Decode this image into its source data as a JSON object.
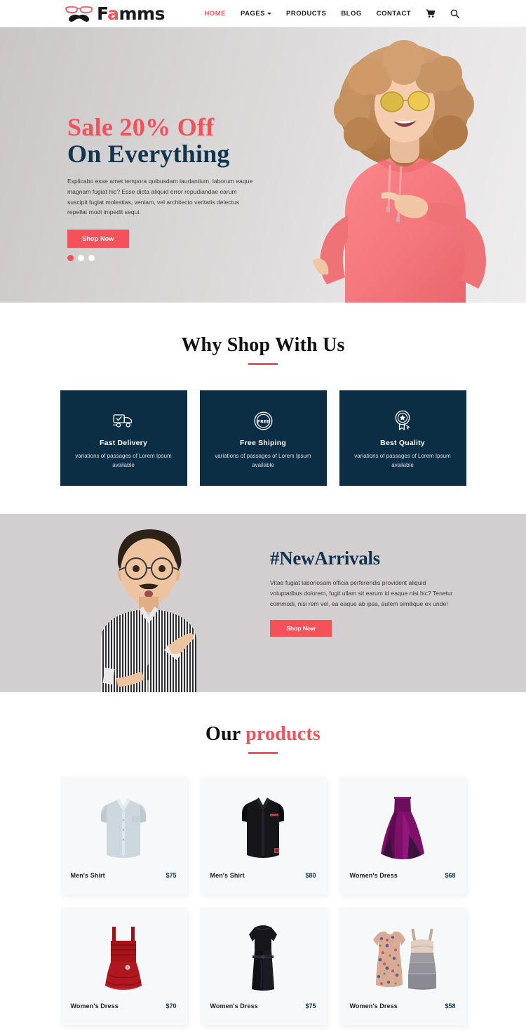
{
  "header": {
    "logo": {
      "part_dark_1": "F",
      "part_red": "a",
      "part_dark_2": "mms",
      "icon": "glasses-mustache-logo"
    },
    "nav": [
      {
        "label": "HOME",
        "active": true
      },
      {
        "label": "PAGES",
        "active": false,
        "has_dropdown": true
      },
      {
        "label": "PRODUCTS",
        "active": false
      },
      {
        "label": "BLOG",
        "active": false
      },
      {
        "label": "CONTACT",
        "active": false
      }
    ],
    "cart_icon": "shopping-cart-icon",
    "search_icon": "search-icon"
  },
  "hero": {
    "title_line1": "Sale 20%  Off",
    "title_line2": "On Everything",
    "description": "Explicabo esse amet tempora quibusdam laudantium, laborum eaque magnam fugiat hic? Esse dicta aliquid error repudiandae earum suscipit fugiat molestias, veniam, vel architecto veritatis delectus repellat modi impedit sequi.",
    "cta_label": "Shop Now",
    "slide_count": 3,
    "active_slide": 1,
    "image_alt": "woman-in-pink-hoodie-with-yellow-sunglasses-pointing"
  },
  "why_shop": {
    "title": "Why Shop With Us",
    "cards": [
      {
        "icon": "delivery-truck-icon",
        "title": "Fast Delivery",
        "desc": "variations of passages of Lorem Ipsum available"
      },
      {
        "icon": "free-badge-icon",
        "title": "Free Shiping",
        "desc": "variations of passages of Lorem Ipsum available"
      },
      {
        "icon": "award-ribbon-icon",
        "title": "Best Quality",
        "desc": "variations of passages of Lorem Ipsum available"
      }
    ]
  },
  "new_arrivals": {
    "title": "#NewArrivals",
    "description": "Vitae fugiat laboriosam officia perferendis provident aliquid voluptatibus dolorem, fugit ullam sit earum id eaque nisi hic? Tenetur commodi, nisi rem vel, ea eaque ab ipsa, autem similique ex unde!",
    "cta_label": "Shop Now",
    "image_alt": "man-with-glasses-in-striped-shirt-pointing"
  },
  "products": {
    "title_plain": "Our ",
    "title_highlight": "products",
    "items": [
      {
        "name": "Men's Shirt",
        "price": "$75",
        "image": "light-blue-dress-shirt"
      },
      {
        "name": "Men's Shirt",
        "price": "$80",
        "image": "black-dress-shirt"
      },
      {
        "name": "Women's Dress",
        "price": "$68",
        "image": "purple-ball-gown"
      },
      {
        "name": "Women's Dress",
        "price": "$70",
        "image": "red-ruffle-dress"
      },
      {
        "name": "Women's Dress",
        "price": "$75",
        "image": "black-sheath-dress"
      },
      {
        "name": "Women's Dress",
        "price": "$58",
        "image": "floral-and-gray-dress-pair"
      }
    ]
  },
  "colors": {
    "accent_red": "#f4515b",
    "navy": "#0c2e44",
    "heading_navy": "#11344f",
    "arrivals_bg": "#d3cfd0",
    "product_card_bg": "#f7f8fa"
  }
}
